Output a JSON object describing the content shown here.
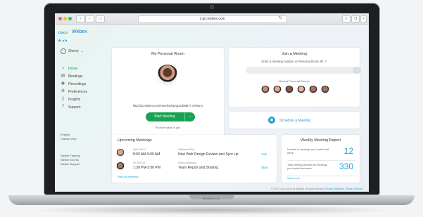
{
  "browser": {
    "url": "ℹ go.webex.com"
  },
  "app": {
    "brand_cisco": "cisco",
    "brand_name": "Webex"
  },
  "sidebar": {
    "user_name": "Sherry",
    "items": [
      {
        "label": "Home",
        "icon": "home-icon",
        "glyph": "⌂",
        "active": true
      },
      {
        "label": "Meetings",
        "icon": "calendar-icon",
        "glyph": "▤",
        "active": false
      },
      {
        "label": "Recordings",
        "icon": "record-icon",
        "glyph": "◉",
        "active": false
      },
      {
        "label": "Preferences",
        "icon": "gear-icon",
        "glyph": "⚙",
        "active": false
      },
      {
        "label": "Insights",
        "icon": "chart-icon",
        "glyph": "❙",
        "active": false
      },
      {
        "label": "Support",
        "icon": "help-icon",
        "glyph": "?",
        "active": false
      }
    ],
    "view_links": [
      "English",
      "Classic View"
    ],
    "footer_links": [
      "Webex Training",
      "Webex Events",
      "Webex Support"
    ]
  },
  "personal_room": {
    "title": "My Personal Room",
    "link": "http://go.webex.com/meet/sdyang12356877.cisherry",
    "start_label": "Start Meeting",
    "more_ways": "⊕ More ways to join"
  },
  "join": {
    "title": "Join a Meeting",
    "instructions": "Enter a meeting number or Personal Room ID ⓘ",
    "go_glyph": "→",
    "recent_label": "Recent Personal Rooms",
    "recent_faces": [
      "#c88d6e",
      "#d9a98c",
      "#7b5a49",
      "#e2b79b",
      "#b0705a",
      "#9c7662"
    ]
  },
  "schedule": {
    "label": "Schedule a Meeting"
  },
  "upcoming": {
    "title": "Upcoming Meetings",
    "meetings": [
      {
        "date": "Wed, Feb 4",
        "time": "8:00 AM-9:00 AM",
        "host": "Catherine Sinu",
        "name": "New Web Design Review and Sync up",
        "action": "Join"
      },
      {
        "date": "Fri, Feb 15",
        "time": "1:30 PM-3:00 PM",
        "host": "Sherry McKenna",
        "name": "Team Report and Sharing",
        "action": "Start"
      }
    ],
    "view_all": "View all meetings"
  },
  "report": {
    "title": "Weekly Meeting Report",
    "stats": [
      {
        "label": "Number of meetings you hosted last week:",
        "value": "12"
      },
      {
        "label": "Total meeting minutes for meetings you hosted last week:",
        "value": "330"
      }
    ],
    "view_more": "View more"
  },
  "footer": {
    "copyright": "© 2014 Cisco and/or its affiliates. All rights reserved. ",
    "links": "Privacy Statement | Terms of Service"
  },
  "laptop": {
    "model": "MacBook Air"
  }
}
